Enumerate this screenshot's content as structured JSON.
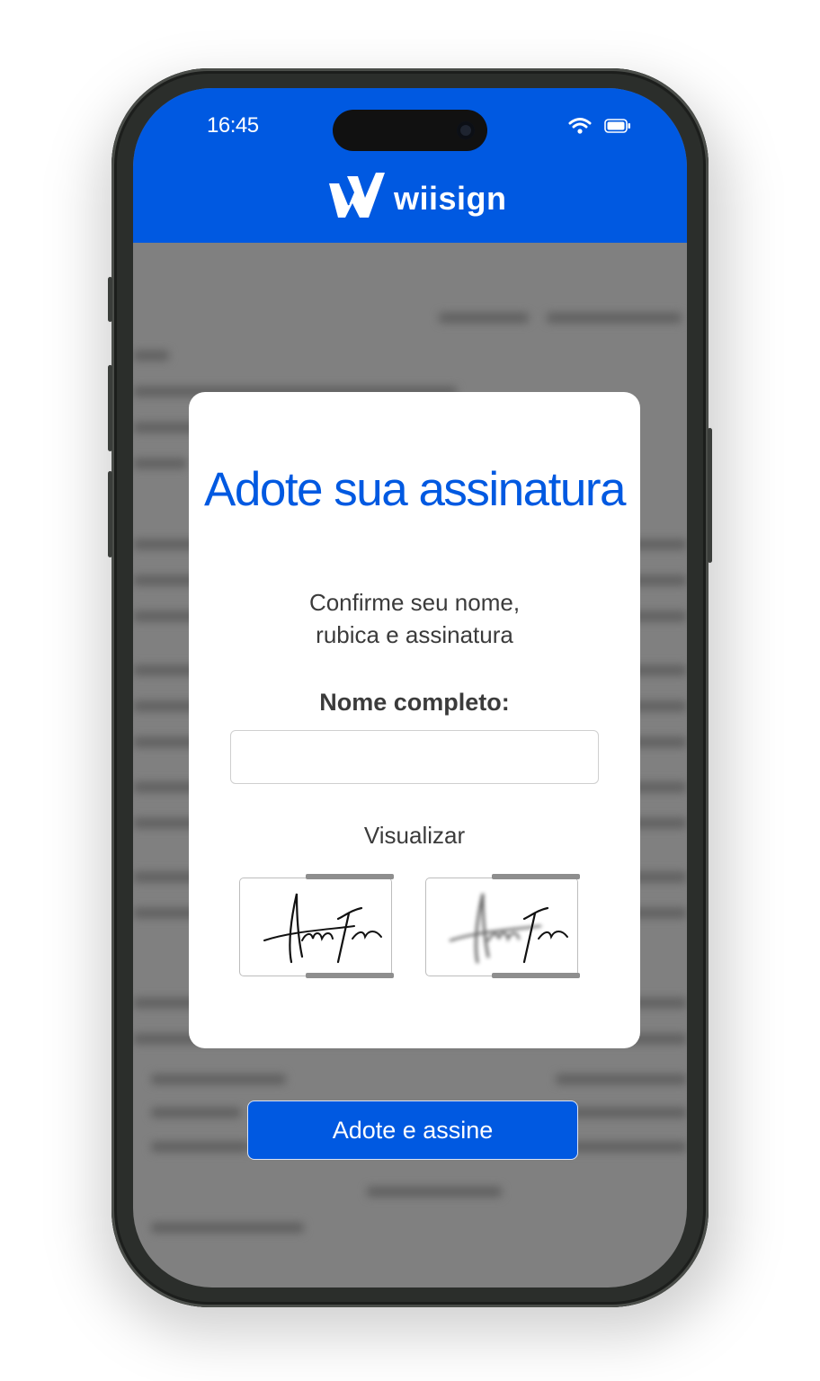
{
  "status_bar": {
    "time": "16:45",
    "icons": [
      "wifi-icon",
      "battery-icon"
    ]
  },
  "header": {
    "logo_text": "wiisign",
    "logo_icon": "wiisign-logo-icon"
  },
  "dialog": {
    "title": "Adote sua assinatura",
    "subtitle": "Confirme seu nome,\nrubica e assinatura",
    "name_label": "Nome completo:",
    "name_value": "",
    "preview_label": "Visualizar",
    "previews": [
      {
        "kind": "signature-preview-sharp",
        "blurred": false
      },
      {
        "kind": "signature-preview-blurred",
        "blurred": true
      }
    ]
  },
  "action": {
    "button_label": "Adote e assine"
  },
  "colors": {
    "brand_blue": "#0059e1",
    "text_dark": "#3b3b3b",
    "overlay_gray": "#808080"
  }
}
